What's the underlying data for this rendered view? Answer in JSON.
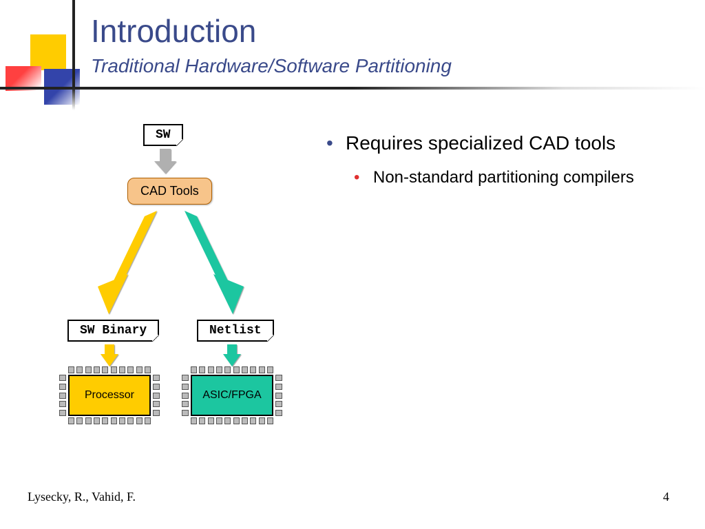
{
  "title": "Introduction",
  "subtitle": "Traditional Hardware/Software Partitioning",
  "bullets": {
    "b1": "Requires specialized CAD tools",
    "b2": "Non-standard partitioning compilers"
  },
  "diagram": {
    "sw": "SW",
    "cad": "CAD Tools",
    "swbin": "SW Binary",
    "netlist": "Netlist",
    "processor": "Processor",
    "asicfpga": "ASIC/FPGA"
  },
  "footer": {
    "authors": "Lysecky, R., Vahid, F.",
    "page": "4"
  },
  "colors": {
    "accent": "#3A4A8A",
    "yellow": "#FFCC00",
    "teal": "#1CC6A0",
    "peach": "#F7C48A",
    "red": "#E03030",
    "gray": "#b0b0b0"
  }
}
